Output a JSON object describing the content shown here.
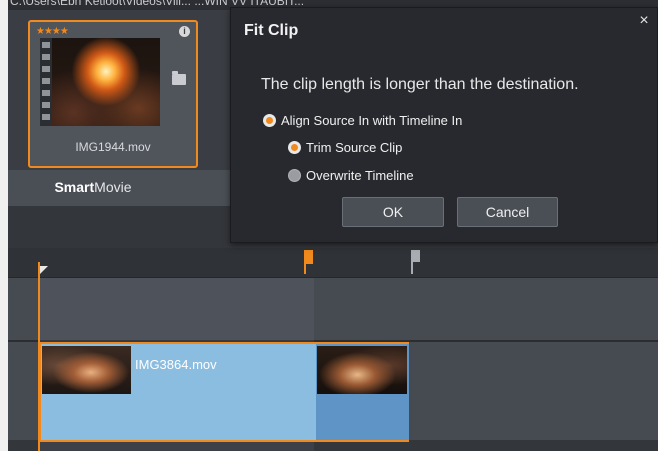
{
  "path_text": "C:\\Users\\Ebn Ketloot\\Videos\\Vill...  ...WIN VV ITAUBIT...",
  "library": {
    "clip": {
      "rating_stars": "★★★★",
      "info_icon": "i",
      "name": "IMG1944.mov"
    },
    "smart_movie": {
      "bold": "Smart",
      "rest": "Movie"
    }
  },
  "timeline": {
    "clip_name": "IMG3864.mov",
    "colors": {
      "selection": "#f0891e",
      "clip_fill": "#8bbde0"
    }
  },
  "dialog": {
    "title": "Fit Clip",
    "close_icon": "×",
    "message": "The clip length is longer than the destination.",
    "options": [
      {
        "label": "Align Source In with Timeline In",
        "selected": true
      },
      {
        "label": "Trim Source Clip",
        "selected": true
      },
      {
        "label": "Overwrite Timeline",
        "selected": false
      }
    ],
    "ok_label": "OK",
    "cancel_label": "Cancel"
  }
}
